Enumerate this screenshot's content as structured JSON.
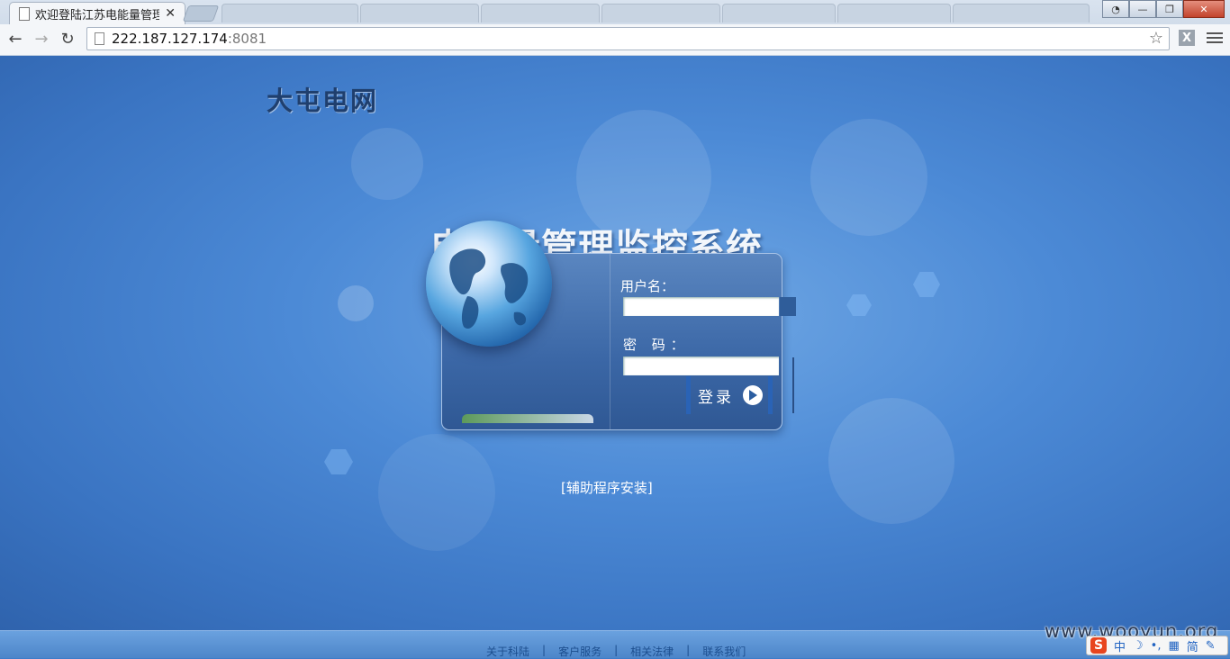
{
  "browser": {
    "active_tab_title": "欢迎登陆江苏电能量管理",
    "url_host": "222.187.127.174",
    "url_port": ":8081",
    "ext_label": "X"
  },
  "page": {
    "brand": "大屯电网",
    "system_title": "电能量管理监控系统",
    "login": {
      "username_label": "用户名：",
      "username_value": "",
      "password_label": "密 码：",
      "password_value": "",
      "submit_label": "登录"
    },
    "helper_link": "[辅助程序安装]"
  },
  "footer": {
    "links": [
      "关于科陆",
      "客户服务",
      "相关法律",
      "联系我们"
    ],
    "separator": "|"
  },
  "watermark": "www.wooyun.org",
  "ime": {
    "logo": "S",
    "mode": "中",
    "simplified": "简"
  },
  "colors": {
    "page_bg": "#3e7dc9",
    "panel_bg": "#3b67a6",
    "brand_text": "#1f3f6e",
    "button_edge": "#2a63b6"
  }
}
